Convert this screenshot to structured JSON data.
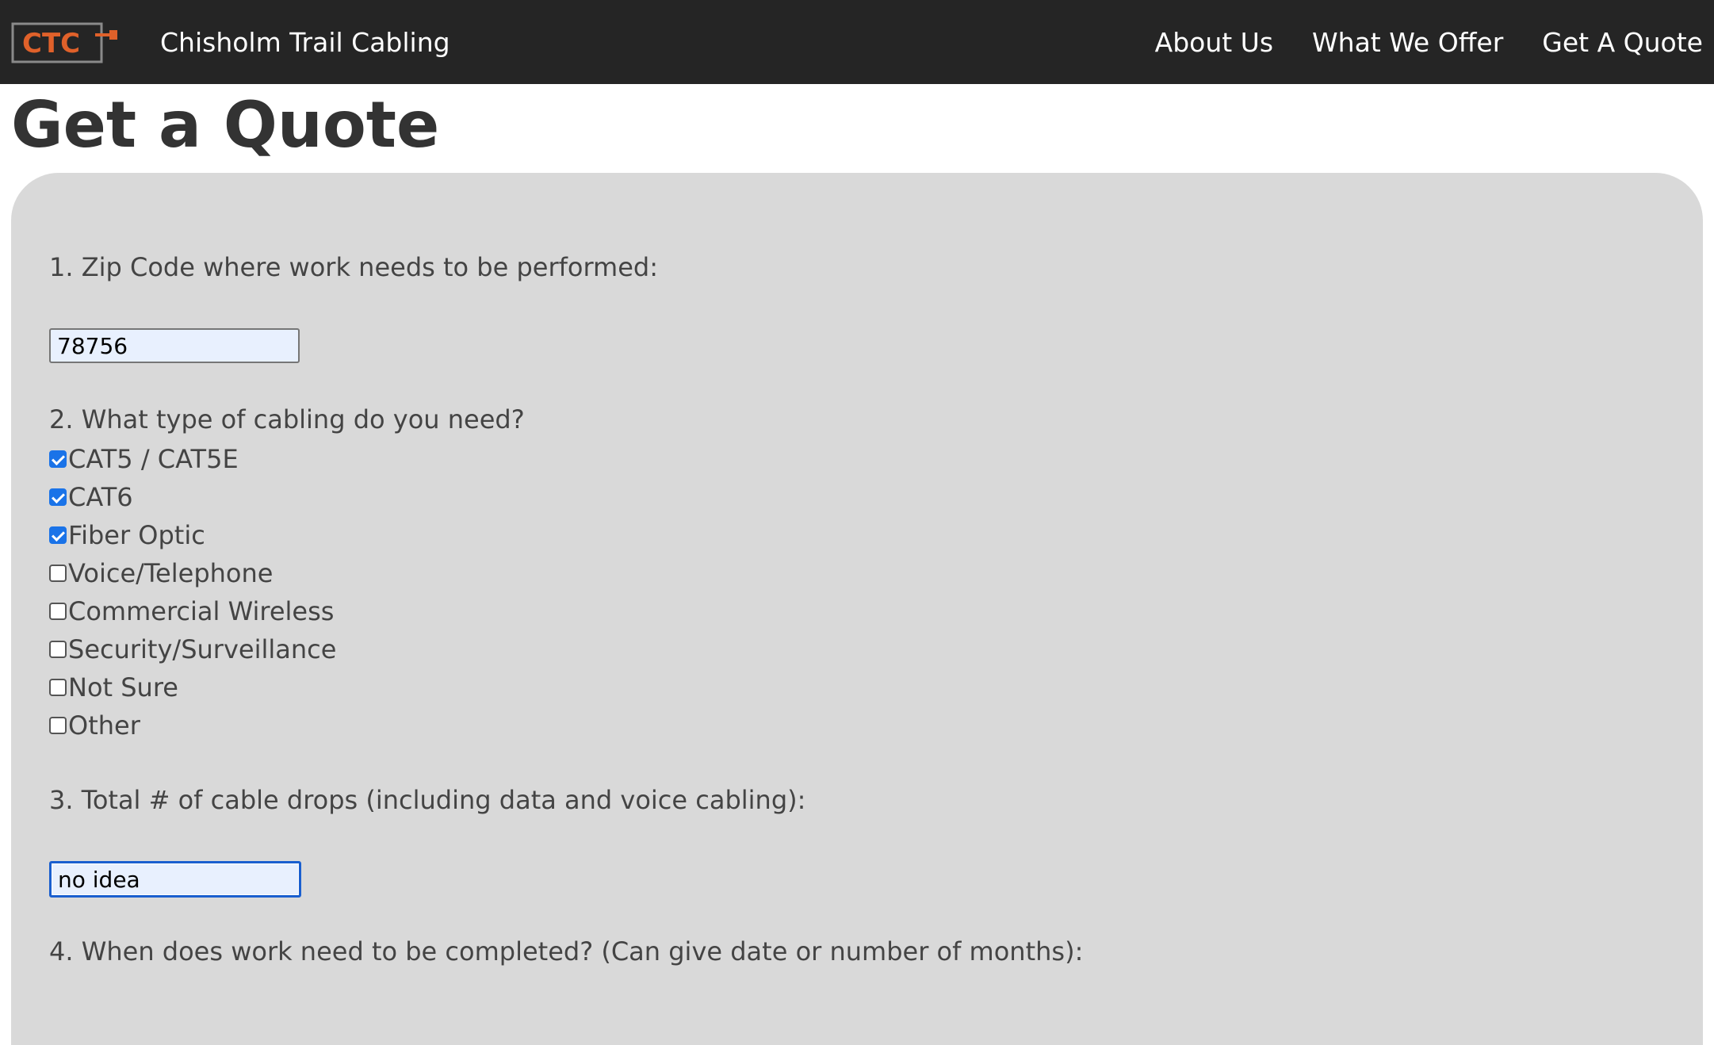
{
  "nav": {
    "logo_text": "CTC",
    "brand": "Chisholm Trail Cabling",
    "links": [
      "About Us",
      "What We Offer",
      "Get A Quote"
    ]
  },
  "page": {
    "title": "Get a Quote"
  },
  "form": {
    "q1": {
      "label": "1. Zip Code where work needs to be performed:",
      "value": "78756"
    },
    "q2": {
      "label": "2. What type of cabling do you need?",
      "options": [
        {
          "label": "CAT5 / CAT5E",
          "checked": true
        },
        {
          "label": "CAT6",
          "checked": true
        },
        {
          "label": "Fiber Optic",
          "checked": true
        },
        {
          "label": "Voice/Telephone",
          "checked": false
        },
        {
          "label": "Commercial Wireless",
          "checked": false
        },
        {
          "label": "Security/Surveillance",
          "checked": false
        },
        {
          "label": "Not Sure",
          "checked": false
        },
        {
          "label": "Other",
          "checked": false
        }
      ]
    },
    "q3": {
      "label": "3. Total # of cable drops (including data and voice cabling):",
      "value": "no idea"
    },
    "q4": {
      "label": "4. When does work need to be completed? (Can give date or number of months):"
    }
  },
  "colors": {
    "navbar": "#252525",
    "panel": "#d9d9d9",
    "accent_orange": "#e0612a",
    "checkbox_blue": "#1a73e8",
    "input_fill": "#e8f0fe"
  }
}
